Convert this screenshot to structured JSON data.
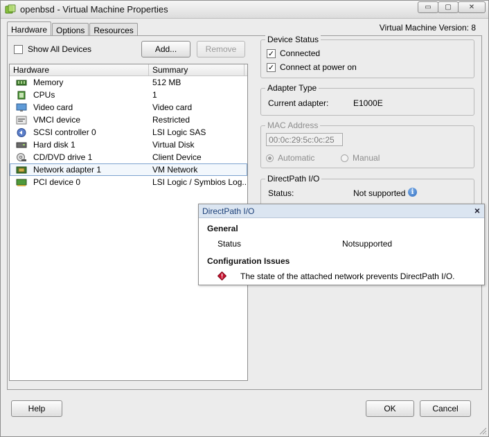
{
  "window": {
    "title": "openbsd - Virtual Machine Properties",
    "controls": {
      "minimize": "▭",
      "maximize": "▢",
      "close": "✕"
    }
  },
  "tabs": [
    {
      "label": "Hardware",
      "active": true
    },
    {
      "label": "Options",
      "active": false
    },
    {
      "label": "Resources",
      "active": false
    }
  ],
  "version_label": "Virtual Machine Version: 8",
  "left": {
    "show_all_devices": {
      "label": "Show All Devices",
      "checked": false
    },
    "add_button": "Add...",
    "remove_button": "Remove",
    "table": {
      "headers": [
        "Hardware",
        "Summary"
      ],
      "rows": [
        {
          "icon": "memory-icon",
          "name": "Memory",
          "summary": "512 MB"
        },
        {
          "icon": "cpu-icon",
          "name": "CPUs",
          "summary": "1"
        },
        {
          "icon": "video-card-icon",
          "name": "Video card",
          "summary": "Video card"
        },
        {
          "icon": "vmci-icon",
          "name": "VMCI device",
          "summary": "Restricted"
        },
        {
          "icon": "scsi-controller-icon",
          "name": "SCSI controller 0",
          "summary": "LSI Logic SAS"
        },
        {
          "icon": "hard-disk-icon",
          "name": "Hard disk 1",
          "summary": "Virtual Disk"
        },
        {
          "icon": "cd-dvd-icon",
          "name": "CD/DVD drive 1",
          "summary": "Client Device"
        },
        {
          "icon": "network-adapter-icon",
          "name": "Network adapter 1",
          "summary": "VM Network",
          "selected": true
        },
        {
          "icon": "pci-device-icon",
          "name": "PCI device 0",
          "summary": "LSI Logic / Symbios Log..."
        }
      ]
    }
  },
  "right": {
    "device_status": {
      "legend": "Device Status",
      "connected": {
        "label": "Connected",
        "checked": true
      },
      "connect_at_power_on": {
        "label": "Connect at power on",
        "checked": true
      }
    },
    "adapter_type": {
      "legend": "Adapter Type",
      "current_label": "Current adapter:",
      "current_value": "E1000E"
    },
    "mac_address": {
      "legend": "MAC Address",
      "value": "00:0c:29:5c:0c:25",
      "automatic": "Automatic",
      "manual": "Manual",
      "selected": "Automatic"
    },
    "directpath": {
      "legend": "DirectPath I/O",
      "status_label": "Status:",
      "status_value": "Not supported"
    }
  },
  "popup": {
    "title": "DirectPath I/O",
    "close": "×",
    "general_heading": "General",
    "status_label": "Status",
    "status_value": "Notsupported",
    "issues_heading": "Configuration Issues",
    "issue_text": "The state of the attached network prevents DirectPath I/O."
  },
  "footer": {
    "help_button": "Help",
    "ok_button": "OK",
    "cancel_button": "Cancel"
  },
  "colors": {
    "selection_border": "#7da2ce",
    "popup_header": "#dbe5f1",
    "info_blue": "#2e6cc0",
    "error_red": "#c8102e"
  }
}
